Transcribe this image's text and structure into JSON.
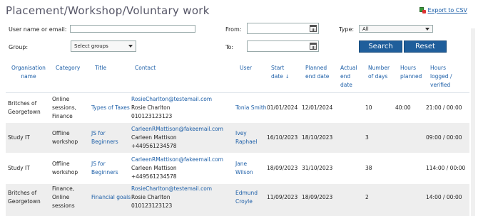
{
  "page": {
    "title": "Placement/Workshop/Voluntary work",
    "export_label": "Export to CSV"
  },
  "filters": {
    "user_label": "User name or email:",
    "user_value": "",
    "group_label": "Group:",
    "group_value": "Select groups",
    "from_label": "From:",
    "from_value": "",
    "to_label": "To:",
    "to_value": "",
    "type_label": "Type:",
    "type_value": "All",
    "search_label": "Search",
    "reset_label": "Reset"
  },
  "table": {
    "headers": {
      "org": [
        "Organisation",
        "name"
      ],
      "category": "Category",
      "title": "Title",
      "contact": "Contact",
      "user": "User",
      "start": [
        "Start",
        "date"
      ],
      "planned_end": [
        "Planned",
        "end date"
      ],
      "actual_end": [
        "Actual",
        "end",
        "date"
      ],
      "days": [
        "Number",
        "of days"
      ],
      "hours_planned": [
        "Hours",
        "planned"
      ],
      "hours_logged": [
        "Hours",
        "logged /",
        "verified"
      ]
    },
    "rows": [
      {
        "org": [
          "Britches of",
          "Georgetown"
        ],
        "category": [
          "Online",
          "sessions,",
          "Finance"
        ],
        "title": [
          "Types of Taxes"
        ],
        "contact_email": "RosieCharlton@testemail.com",
        "contact_name": "Rosie Charlton",
        "contact_phone": "010123123123",
        "user": [
          "Tonia Smith"
        ],
        "start": "01/01/2024",
        "planned_end": "12/01/2024",
        "actual_end": "",
        "days": "10",
        "hours_planned": "40:00",
        "hours_logged": "21:00 / 00:00"
      },
      {
        "org": [
          "Study IT"
        ],
        "category": [
          "Offline",
          "workshop"
        ],
        "title": [
          "JS for",
          "Beginners"
        ],
        "contact_email": "CarleenRMattison@fakeemail.com",
        "contact_name": "Carleen Mattison",
        "contact_phone": "+449561234578",
        "user": [
          "Ivey",
          "Raphael"
        ],
        "start": "16/10/2023",
        "planned_end": "18/10/2023",
        "actual_end": "",
        "days": "3",
        "hours_planned": "",
        "hours_logged": "09:00 / 00:00"
      },
      {
        "org": [
          "Study IT"
        ],
        "category": [
          "Offline",
          "workshop"
        ],
        "title": [
          "JS for",
          "Beginners"
        ],
        "contact_email": "CarleenRMattison@fakeemail.com",
        "contact_name": "Carleen Mattison",
        "contact_phone": "+449561234578",
        "user": [
          "Jane",
          "Wilson"
        ],
        "start": "18/09/2023",
        "planned_end": "31/10/2023",
        "actual_end": "",
        "days": "38",
        "hours_planned": "",
        "hours_logged": "114:00 / 00:00"
      },
      {
        "org": [
          "Britches of",
          "Georgetown"
        ],
        "category": [
          "Finance,",
          "Online",
          "sessions"
        ],
        "title": [
          "Financial goals"
        ],
        "contact_email": "RosieCharlton@testemail.com",
        "contact_name": "Rosie Charlton",
        "contact_phone": "010123123123",
        "user": [
          "Edmund",
          "Croyle"
        ],
        "start": "11/09/2023",
        "planned_end": "18/09/2023",
        "actual_end": "",
        "days": "2",
        "hours_planned": "",
        "hours_logged": "14:00 / 00:00"
      }
    ]
  }
}
